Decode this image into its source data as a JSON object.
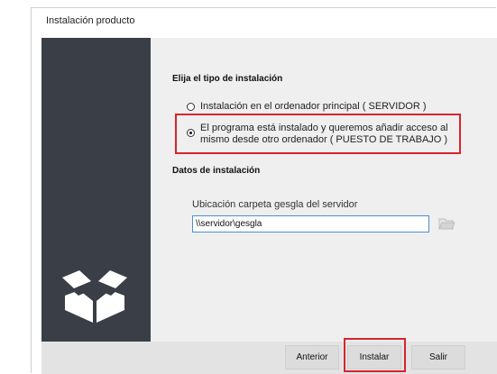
{
  "window": {
    "title": "Instalación producto"
  },
  "installation_type": {
    "heading": "Elija el tipo de instalación",
    "options": [
      {
        "label": "Instalación en el ordenador principal ( SERVIDOR  )",
        "selected": false
      },
      {
        "label": "El programa está instalado y queremos añadir acceso al\nmismo desde otro ordenador ( PUESTO DE TRABAJO )",
        "selected": true
      }
    ]
  },
  "install_data": {
    "heading": "Datos de instalación",
    "server_folder_label": "Ubicación carpeta gesgla del servidor",
    "server_folder_value": "\\\\servidor\\gesgla"
  },
  "buttons": {
    "previous": "Anterior",
    "install": "Instalar",
    "exit": "Salir"
  },
  "colors": {
    "side_panel": "#3a3f47",
    "highlight": "#d6252d",
    "input_focus": "#4a8fd6"
  },
  "icons": {
    "logo": "open-box-icon",
    "browse": "folder-icon"
  }
}
